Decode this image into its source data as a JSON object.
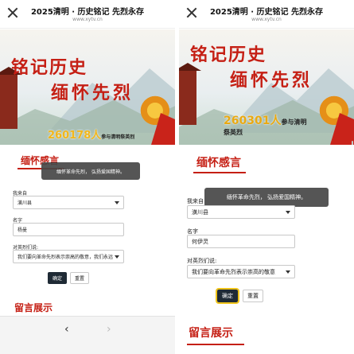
{
  "left": {
    "header": {
      "title": "2025清明 · 历史铭记 先烈永存",
      "url": "www.xytv.cn"
    },
    "banner": {
      "slogan_line1": "铭记历史",
      "slogan_line2": "缅怀先烈",
      "count": "260178人",
      "count_suffix": "参与清明祭英烈"
    },
    "section_title": "缅怀感言",
    "toast": "缅怀革命先烈， 弘扬爱国精神。",
    "form": {
      "from_label": "我来自",
      "from_value": "潢川县",
      "name_label": "名字",
      "name_value": "杨曼",
      "message_label": "对英烈们说:",
      "message_value": "我们要向革命先烈表示崇高的敬意，我们永远"
    },
    "buttons": {
      "confirm": "确定",
      "reset": "重置"
    },
    "messages_title": "留言展示",
    "nav": {
      "back": "‹",
      "forward": "›"
    }
  },
  "right": {
    "header": {
      "title": "2025清明 · 历史铭记 先烈永存",
      "url": "www.xytv.cn"
    },
    "banner": {
      "slogan_line1": "铭记历史",
      "slogan_line2": "缅怀先烈",
      "count": "260301人",
      "count_suffix": "参与清明",
      "count_suffix2": "祭英烈"
    },
    "section_title": "缅怀感言",
    "toast": "缅怀革命先烈， 弘扬爱国精神。",
    "form": {
      "from_label": "我来自",
      "from_value": "潢川县",
      "name_label": "名字",
      "name_value": "何伊灵",
      "message_label": "对英烈们说:",
      "message_value": "我们要向革命先烈表示崇高的敬意"
    },
    "buttons": {
      "confirm": "确定",
      "reset": "重置"
    },
    "messages_title": "留言展示"
  },
  "colors": {
    "accent_red": "#c51f14",
    "count_gold": "#f2b61a",
    "button_dark": "#1f2a35",
    "focus_ring": "#f0c419"
  },
  "icons": {
    "close": "close-icon",
    "back": "chevron-left-icon",
    "forward": "chevron-right-icon",
    "dropdown": "caret-down-icon"
  }
}
